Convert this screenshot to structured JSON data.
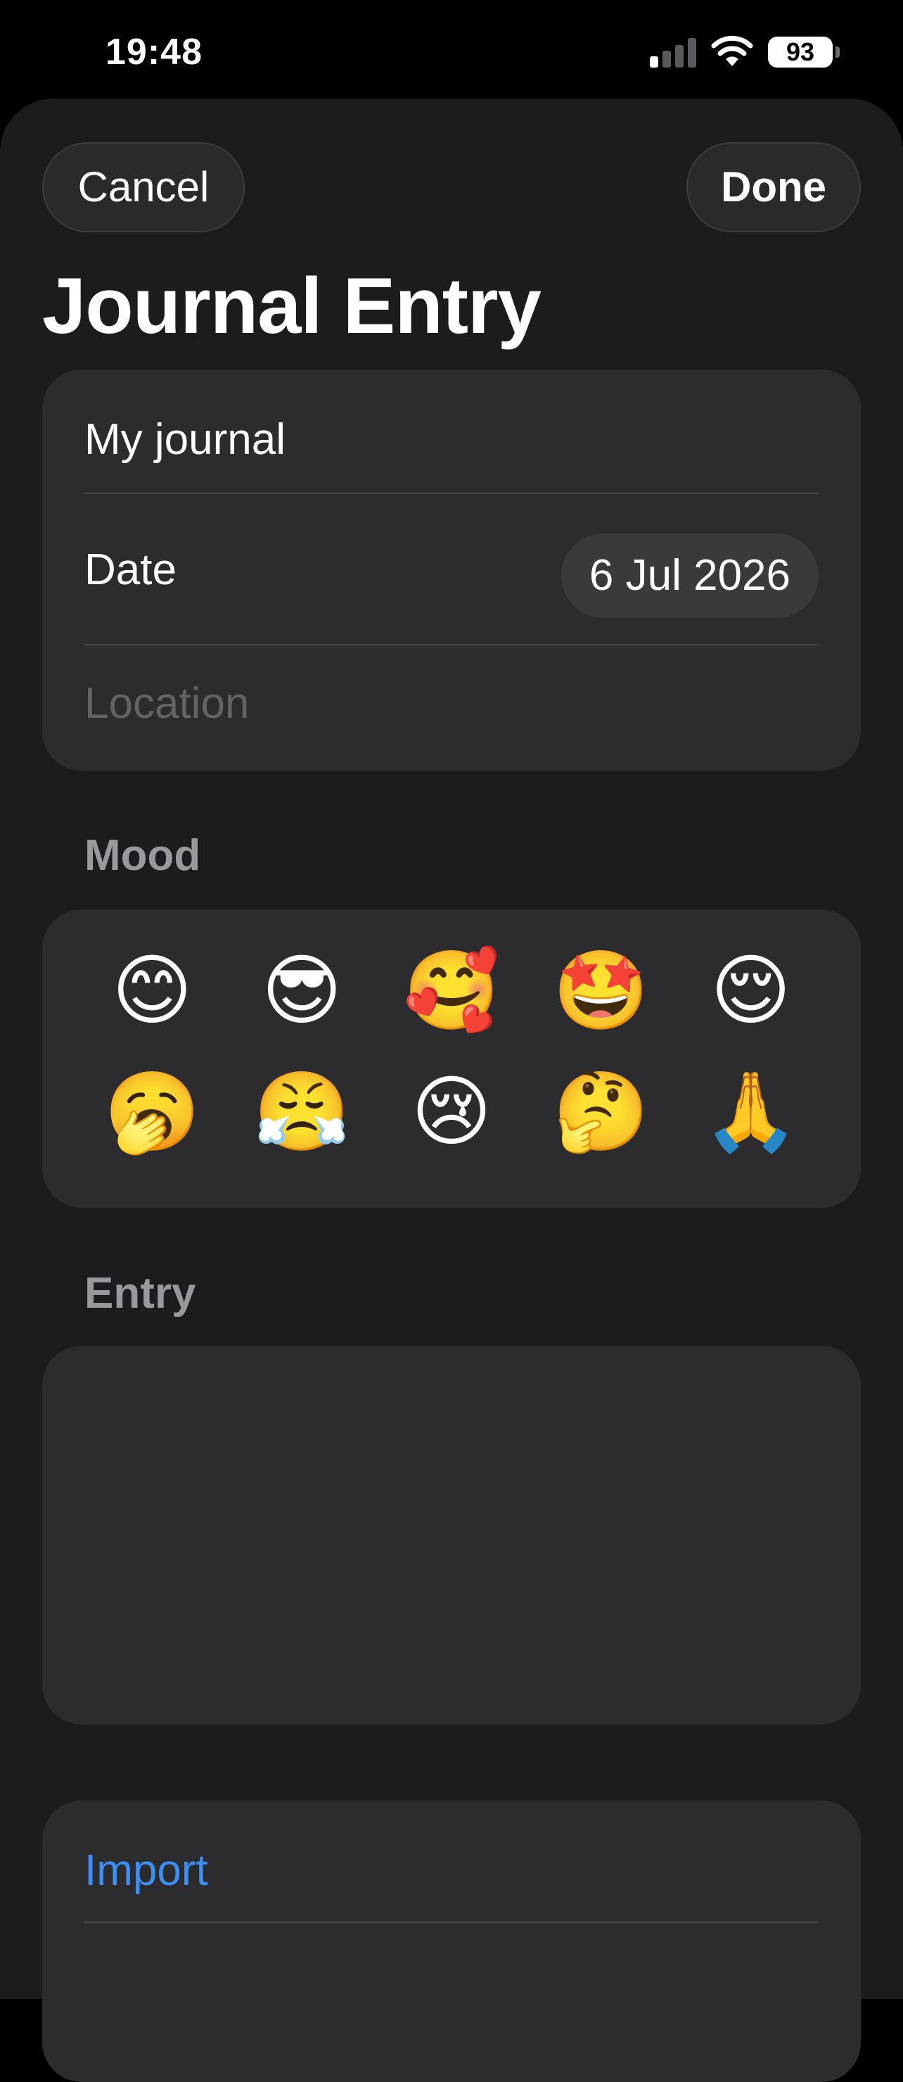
{
  "status_bar": {
    "time": "19:48",
    "battery": "93",
    "signal_bars_active": 1,
    "signal_bars_total": 4
  },
  "header": {
    "cancel_label": "Cancel",
    "done_label": "Done",
    "title": "Journal Entry"
  },
  "details": {
    "journal_name": "My journal",
    "date_label": "Date",
    "date_value": "6 Jul 2026",
    "location_placeholder": "Location"
  },
  "mood": {
    "label": "Mood",
    "emojis": [
      "😊",
      "😎",
      "🥰",
      "🤩",
      "😌",
      "🥱",
      "😤",
      "😢",
      "🤔",
      "🙏"
    ]
  },
  "entry": {
    "label": "Entry",
    "text": ""
  },
  "actions": {
    "import_label": "Import"
  },
  "colors": {
    "background": "#000000",
    "sheet": "#1c1c1e",
    "card": "#2c2c2e",
    "link": "#3b8ff5",
    "secondary_text": "#98989d"
  }
}
